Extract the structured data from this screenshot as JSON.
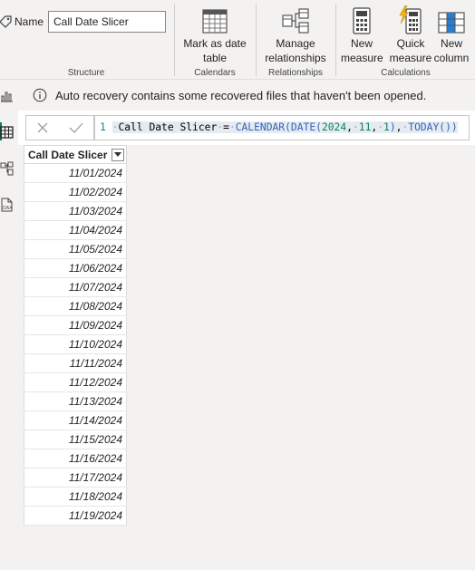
{
  "ribbon": {
    "structure": {
      "name_label": "Name",
      "name_value": "Call Date Slicer",
      "group_label": "Structure"
    },
    "calendars": {
      "mark_as_date_table_line1": "Mark as date",
      "mark_as_date_table_line2": "table",
      "group_label": "Calendars"
    },
    "relationships": {
      "manage_line1": "Manage",
      "manage_line2": "relationships",
      "group_label": "Relationships"
    },
    "calculations": {
      "new_measure_line1": "New",
      "new_measure_line2": "measure",
      "quick_measure_line1": "Quick",
      "quick_measure_line2": "measure",
      "new_column_line1": "New",
      "new_column_line2": "column",
      "group_label": "Calculations"
    }
  },
  "left_nav": {
    "items": [
      "report-view-icon",
      "table-view-icon",
      "model-view-icon",
      "dax-query-view-icon"
    ],
    "active": "table-view-icon"
  },
  "info_bar": {
    "icon": "info-icon",
    "message": "Auto recovery contains some recovered files that haven't been opened."
  },
  "formula_bar": {
    "line_number": "1",
    "table_name": "Call Date Slicer",
    "equals": "=",
    "calendar_fn": "CALENDAR(",
    "date_fn": "DATE(",
    "year": "2024",
    "month": "11",
    "day": "1",
    "close1": ")",
    "today_fn": "TODAY()",
    "close2": ")",
    "comma": ",",
    "ws": "·"
  },
  "table": {
    "column_header": "Call Date Slicer",
    "rows": [
      "11/01/2024",
      "11/02/2024",
      "11/03/2024",
      "11/04/2024",
      "11/05/2024",
      "11/06/2024",
      "11/07/2024",
      "11/08/2024",
      "11/09/2024",
      "11/10/2024",
      "11/11/2024",
      "11/12/2024",
      "11/13/2024",
      "11/14/2024",
      "11/15/2024",
      "11/16/2024",
      "11/17/2024",
      "11/18/2024",
      "11/19/2024"
    ]
  },
  "colors": {
    "accent": "#117865",
    "function": "#3165bb",
    "number": "#098658",
    "ribbon_bg": "#f3f2f1"
  }
}
